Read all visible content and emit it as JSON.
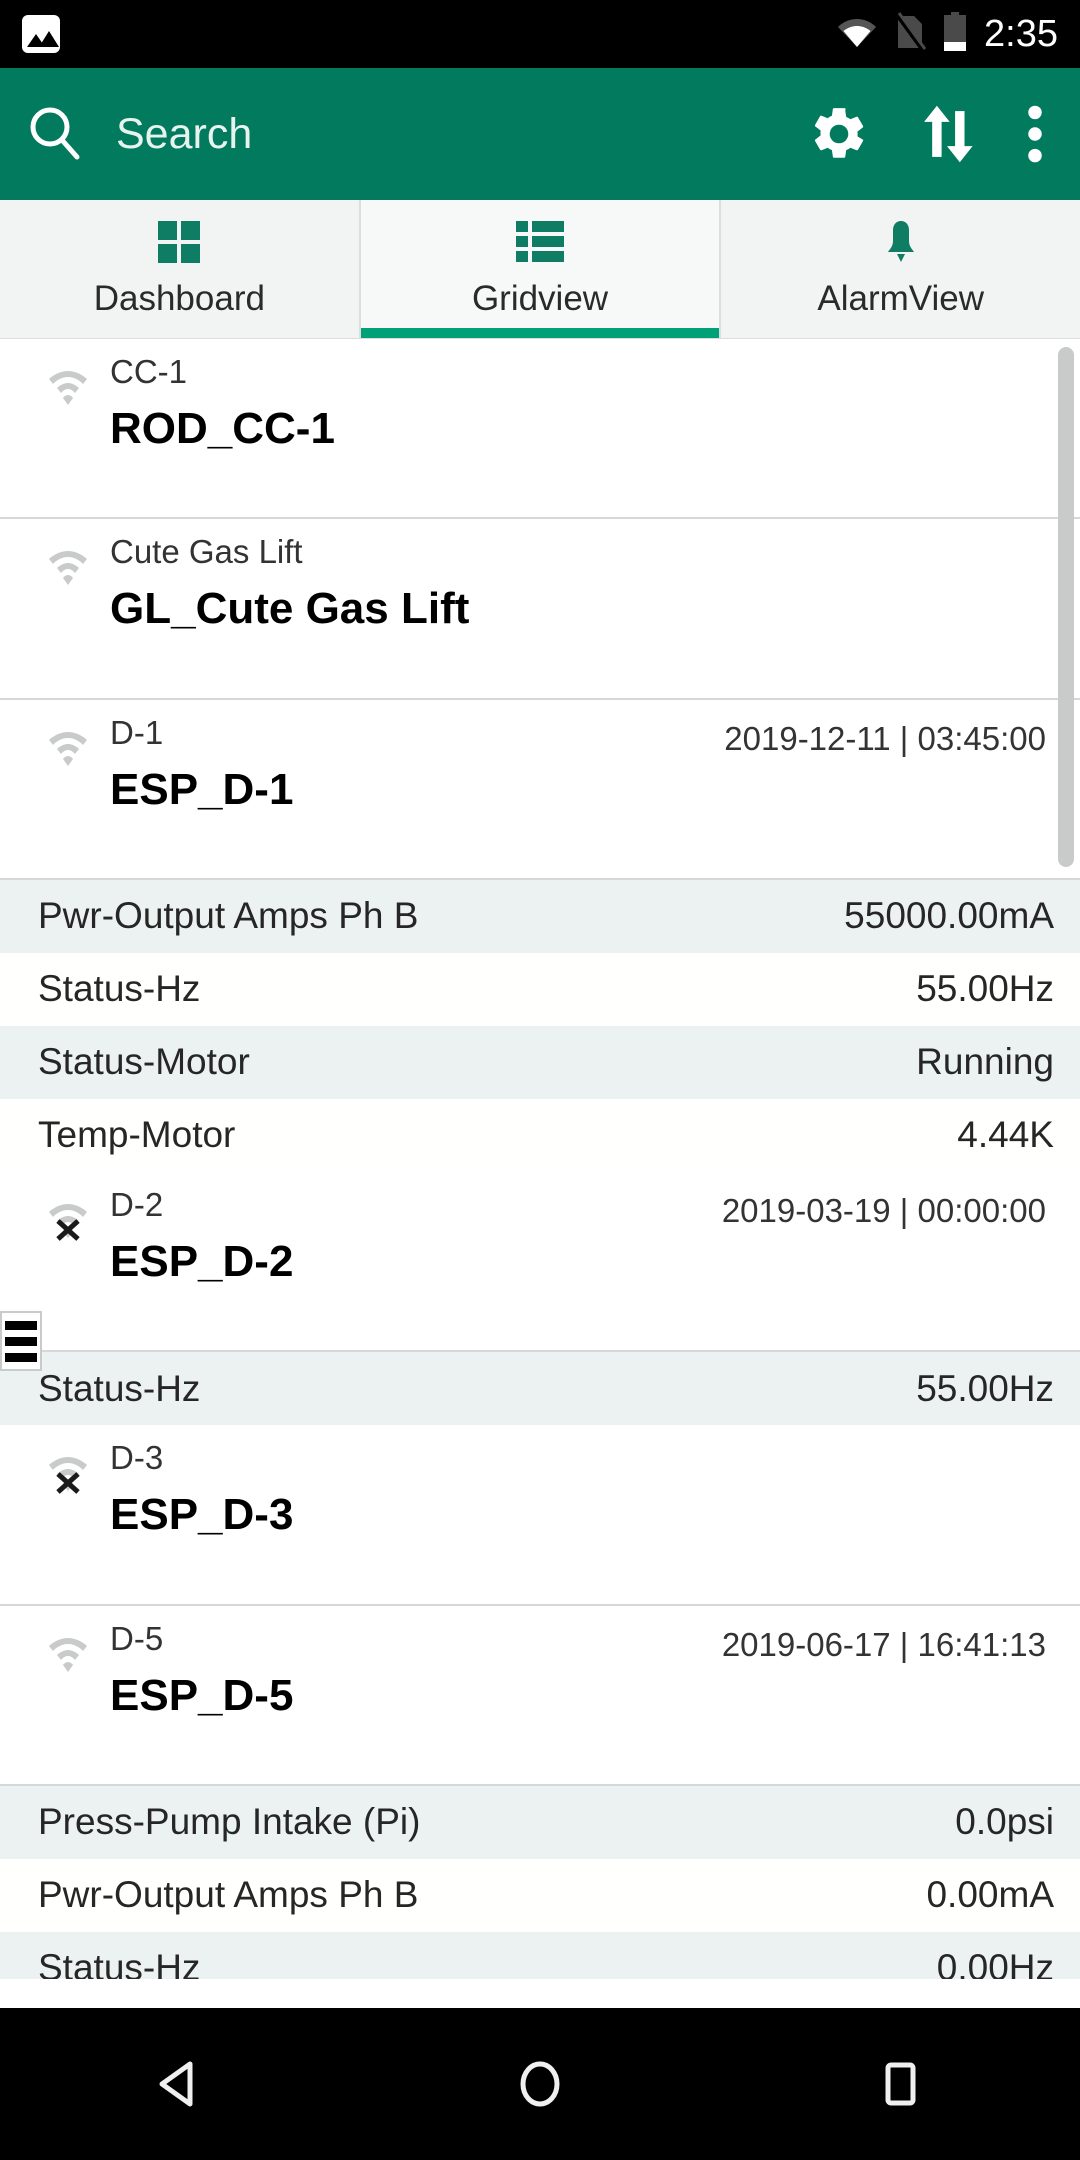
{
  "status_bar": {
    "time": "2:35",
    "icons": [
      "screenshot-icon",
      "wifi-icon",
      "no-sim-icon",
      "battery-icon"
    ]
  },
  "toolbar": {
    "search_placeholder": "Search",
    "actions": [
      "settings-gear-icon",
      "sort-updown-icon",
      "overflow-menu-icon"
    ]
  },
  "tabs": [
    {
      "label": "Dashboard",
      "icon": "grid-icon",
      "selected": false
    },
    {
      "label": "Gridview",
      "icon": "list-icon",
      "selected": true
    },
    {
      "label": "AlarmView",
      "icon": "bell-icon",
      "selected": false
    }
  ],
  "devices": [
    {
      "id": "CC-1",
      "name": "ROD_CC-1",
      "timestamp": "",
      "signal": "online",
      "metrics": []
    },
    {
      "id": "Cute Gas Lift",
      "name": "GL_Cute Gas Lift",
      "timestamp": "",
      "signal": "online",
      "metrics": []
    },
    {
      "id": "D-1",
      "name": "ESP_D-1",
      "timestamp": "2019-12-11 | 03:45:00",
      "signal": "online",
      "metrics": [
        {
          "label": "Pwr-Output Amps Ph B",
          "value": "55000.00mA"
        },
        {
          "label": "Status-Hz",
          "value": "55.00Hz"
        },
        {
          "label": "Status-Motor",
          "value": "Running"
        },
        {
          "label": "Temp-Motor",
          "value": "4.44K"
        }
      ]
    },
    {
      "id": "D-2",
      "name": "ESP_D-2",
      "timestamp": "2019-03-19 | 00:00:00",
      "signal": "offline",
      "metrics": [
        {
          "label": "Status-Hz",
          "value": "55.00Hz"
        }
      ]
    },
    {
      "id": "D-3",
      "name": "ESP_D-3",
      "timestamp": "",
      "signal": "offline",
      "metrics": []
    },
    {
      "id": "D-5",
      "name": "ESP_D-5",
      "timestamp": "2019-06-17 | 16:41:13",
      "signal": "online",
      "metrics": [
        {
          "label": "Press-Pump Intake (Pi)",
          "value": "0.0psi"
        },
        {
          "label": "Pwr-Output Amps Ph B",
          "value": "0.00mA"
        },
        {
          "label": "Status-Hz",
          "value": "0.00Hz"
        }
      ]
    }
  ],
  "nav_bar": {
    "buttons": [
      "back-icon",
      "home-icon",
      "recents-icon"
    ]
  },
  "colors": {
    "toolbar_green": "#027A5E",
    "tab_indicator": "#00A078",
    "tab_icon": "#0E7D63",
    "row_tint": "#ecf2f1"
  }
}
